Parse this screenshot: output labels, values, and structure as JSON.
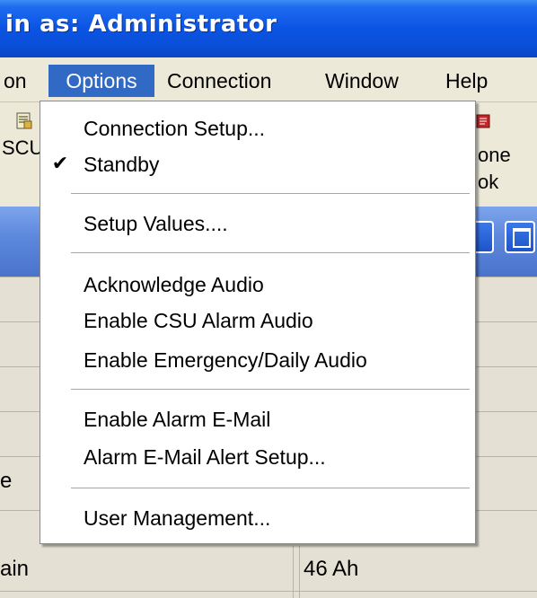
{
  "window": {
    "title": "in as: Administrator"
  },
  "menubar": {
    "items": [
      {
        "label": "on"
      },
      {
        "label": "Options"
      },
      {
        "label": "Connection"
      },
      {
        "label": "Window"
      },
      {
        "label": "Help"
      }
    ]
  },
  "toolbar": {
    "left_button_label": "SCU",
    "right_button_label_line1": "one",
    "right_button_label_line2": "ok",
    "left_icon": "document-icon",
    "right_icon": "phone-book-icon"
  },
  "options_menu": {
    "connection_setup": "Connection Setup...",
    "standby": "Standby",
    "standby_checked": true,
    "check_glyph": "✔",
    "setup_values": "Setup Values....",
    "acknowledge_audio": "Acknowledge Audio",
    "enable_csu_alarm_audio": "Enable CSU Alarm Audio",
    "enable_emergency_daily_audio": "Enable Emergency/Daily Audio",
    "enable_alarm_email": "Enable Alarm E-Mail",
    "alarm_email_alert_setup": "Alarm E-Mail Alert Setup...",
    "user_management": "User Management..."
  },
  "grid": {
    "partial_row_label": "e",
    "bottom_row_label": "ain",
    "bottom_row_value": "46 Ah"
  },
  "colors": {
    "titlebar_blue": "#0b54e3",
    "menu_highlight": "#316ac5",
    "menubar_bg": "#ece9d8"
  }
}
